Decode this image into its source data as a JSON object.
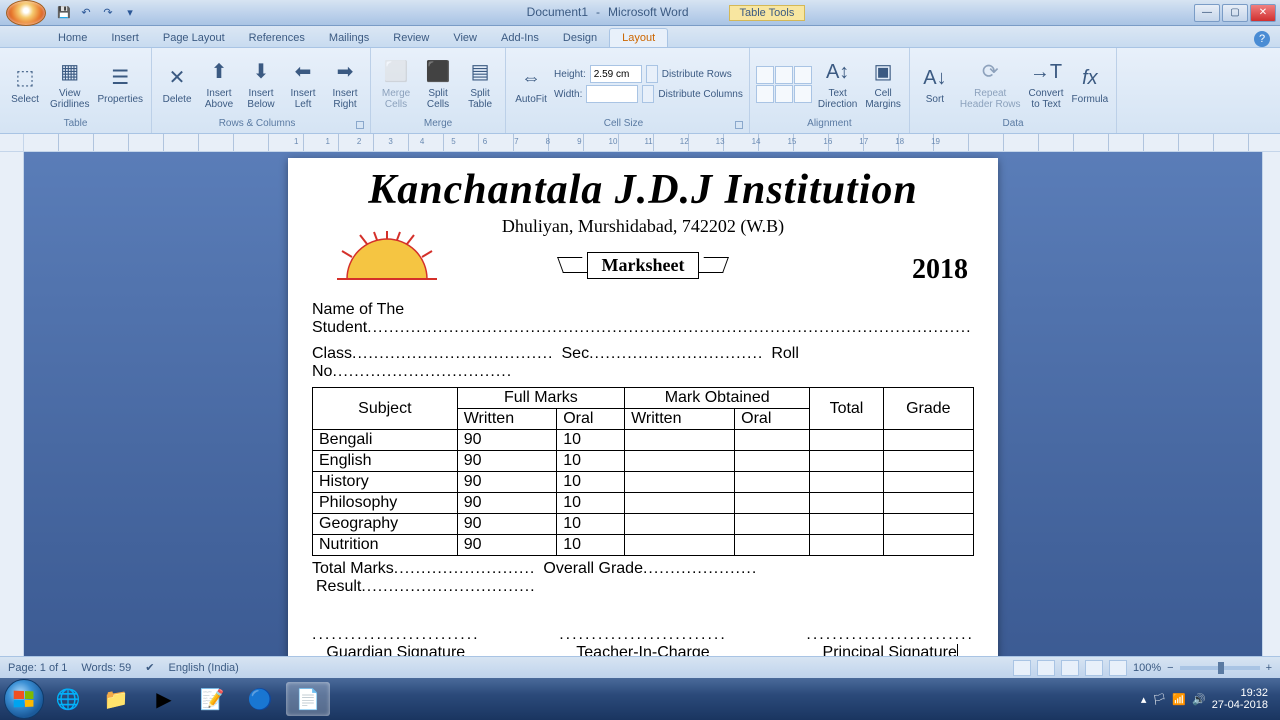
{
  "titlebar": {
    "doc_name": "Document1",
    "app_name": "Microsoft Word",
    "context_tab": "Table Tools"
  },
  "tabs": [
    "Home",
    "Insert",
    "Page Layout",
    "References",
    "Mailings",
    "Review",
    "View",
    "Add-Ins",
    "Design",
    "Layout"
  ],
  "active_tab": "Layout",
  "ribbon": {
    "groups": {
      "table": {
        "label": "Table",
        "select": "Select",
        "gridlines": "View\nGridlines",
        "properties": "Properties"
      },
      "rows_cols": {
        "label": "Rows & Columns",
        "delete": "Delete",
        "above": "Insert\nAbove",
        "below": "Insert\nBelow",
        "left": "Insert\nLeft",
        "right": "Insert\nRight"
      },
      "merge": {
        "label": "Merge",
        "merge": "Merge\nCells",
        "split": "Split\nCells",
        "split_table": "Split\nTable"
      },
      "cell_size": {
        "label": "Cell Size",
        "autofit": "AutoFit",
        "height_label": "Height:",
        "height_val": "2.59 cm",
        "width_label": "Width:",
        "width_val": "",
        "dist_rows": "Distribute Rows",
        "dist_cols": "Distribute Columns"
      },
      "alignment": {
        "label": "Alignment",
        "text_dir": "Text\nDirection",
        "margins": "Cell\nMargins"
      },
      "data": {
        "label": "Data",
        "sort": "Sort",
        "repeat": "Repeat\nHeader Rows",
        "convert": "Convert\nto Text",
        "formula": "Formula"
      }
    }
  },
  "document": {
    "title": "Kanchantala J.D.J Institution",
    "address": "Dhuliyan, Murshidabad, 742202 (W.B)",
    "banner": "Marksheet",
    "year": "2018",
    "fields": {
      "name": "Name of The Student",
      "class": "Class",
      "sec": "Sec",
      "roll": "Roll No"
    },
    "table": {
      "headers": {
        "subject": "Subject",
        "full_marks": "Full Marks",
        "mark_obtained": "Mark Obtained",
        "written": "Written",
        "oral": "Oral",
        "total": "Total",
        "grade": "Grade"
      },
      "rows": [
        {
          "subject": "Bengali",
          "fw": "90",
          "fo": "10"
        },
        {
          "subject": "English",
          "fw": "90",
          "fo": "10"
        },
        {
          "subject": "History",
          "fw": "90",
          "fo": "10"
        },
        {
          "subject": "Philosophy",
          "fw": "90",
          "fo": "10"
        },
        {
          "subject": "Geography",
          "fw": "90",
          "fo": "10"
        },
        {
          "subject": "Nutrition",
          "fw": "90",
          "fo": "10"
        }
      ]
    },
    "summary": {
      "total_marks": "Total Marks",
      "overall_grade": "Overall Grade",
      "result": "Result"
    },
    "signatures": {
      "guardian": "Guardian Signature",
      "teacher": "Teacher-In-Charge",
      "principal": "Principal Signature"
    }
  },
  "status": {
    "page": "Page: 1 of 1",
    "words": "Words: 59",
    "lang": "English (India)",
    "zoom": "100%"
  },
  "tray": {
    "time": "19:32",
    "date": "27-04-2018"
  }
}
